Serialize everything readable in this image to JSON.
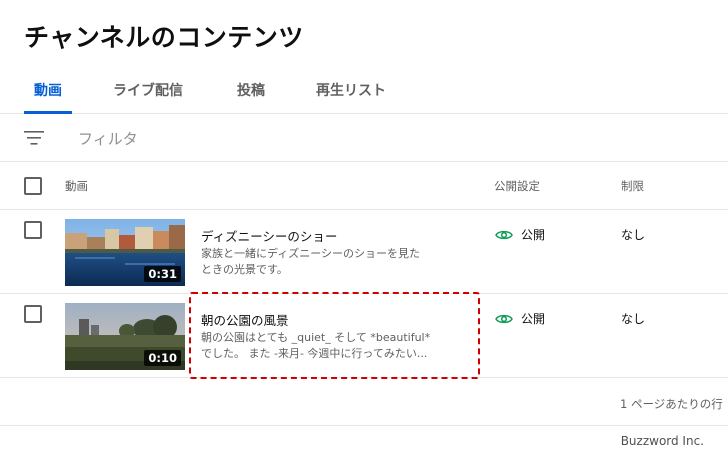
{
  "page": {
    "title": "チャンネルのコンテンツ"
  },
  "tabs": [
    {
      "label": "動画",
      "active": true
    },
    {
      "label": "ライブ配信",
      "active": false
    },
    {
      "label": "投稿",
      "active": false
    },
    {
      "label": "再生リスト",
      "active": false
    }
  ],
  "filter": {
    "placeholder": "フィルタ",
    "icon": "filter-lines-icon"
  },
  "table": {
    "headers": {
      "video": "動画",
      "visibility": "公開設定",
      "restriction": "制限"
    },
    "rows": [
      {
        "title": "ディズニーシーのショー",
        "description_line1": "家族と一緒にディズニーシーのショーを見た",
        "description_line2": "ときの光景です。",
        "duration": "0:31",
        "visibility": "公開",
        "restriction": "なし"
      },
      {
        "title": "朝の公園の風景",
        "description_line1": "朝の公園はとても _quiet_ そして *beautiful*",
        "description_line2": "でした。 また -来月- 今週中に行ってみたい...",
        "duration": "0:10",
        "visibility": "公開",
        "restriction": "なし"
      }
    ]
  },
  "footer": {
    "rows_per_page_label": "1 ページあたりの行"
  },
  "watermark": "Buzzword Inc.",
  "colors": {
    "accent": "#065fd4",
    "public_eye": "#0f9d58",
    "highlight": "#d00000"
  }
}
